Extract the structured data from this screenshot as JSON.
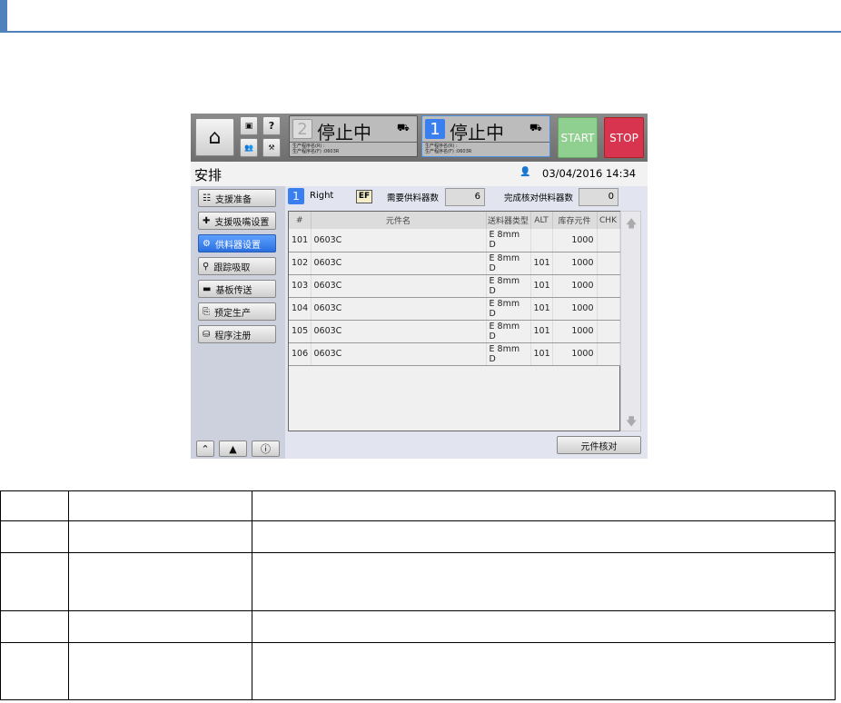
{
  "screen": {
    "status_left": {
      "num": "2",
      "text": "停止中",
      "line1": "生产程序名(R) :",
      "line2": "生产程序名(F) :0603R"
    },
    "status_right": {
      "num": "1",
      "text": "停止中",
      "line1": "生产程序名(R) :",
      "line2": "生产程序名(F) :0603R"
    },
    "start_label": "START",
    "stop_label": "STOP",
    "title": "安排",
    "datetime": "03/04/2016 14:34",
    "sidebar": [
      {
        "label": "支援准备",
        "icon": "list-icon"
      },
      {
        "label": "支援吸嘴设置",
        "icon": "nozzle-icon"
      },
      {
        "label": "供料器设置",
        "icon": "feeder-icon",
        "active": true
      },
      {
        "label": "跟踪吸取",
        "icon": "trace-icon"
      },
      {
        "label": "基板传送",
        "icon": "conveyor-icon"
      },
      {
        "label": "预定生产",
        "icon": "schedule-icon"
      },
      {
        "label": "程序注册",
        "icon": "register-icon"
      }
    ],
    "lane_num": "1",
    "lane": "Right",
    "ef": "EF",
    "need_label": "需要供料器数",
    "need_value": "6",
    "done_label": "完成核对供料器数",
    "done_value": "0",
    "columns": [
      "#",
      "元件名",
      "送料器类型",
      "ALT",
      "库存元件",
      "CHK"
    ],
    "rows": [
      [
        "101",
        "0603C",
        "E 8mm D",
        "",
        "1000",
        ""
      ],
      [
        "102",
        "0603C",
        "E 8mm D",
        "101",
        "1000",
        ""
      ],
      [
        "103",
        "0603C",
        "E 8mm D",
        "101",
        "1000",
        ""
      ],
      [
        "104",
        "0603C",
        "E 8mm D",
        "101",
        "1000",
        ""
      ],
      [
        "105",
        "0603C",
        "E 8mm D",
        "101",
        "1000",
        ""
      ],
      [
        "106",
        "0603C",
        "E 8mm D",
        "101",
        "1000",
        ""
      ]
    ],
    "verify_label": "元件核对",
    "colors": {
      "accent": "#2a6fe0",
      "start": "#8fcf8f",
      "stop": "#d9344f"
    }
  }
}
